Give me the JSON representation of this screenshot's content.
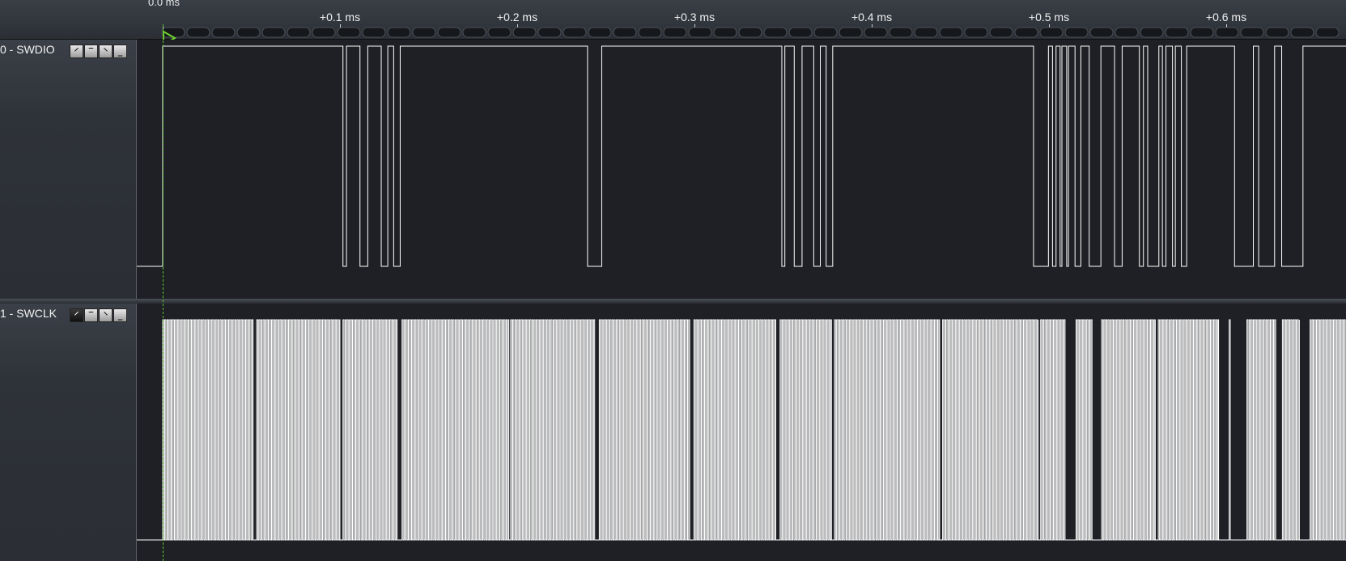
{
  "ruler": {
    "origin_label": "0.0 ms",
    "ticks": [
      "+0.1 ms",
      "+0.2 ms",
      "+0.3 ms",
      "+0.4 ms",
      "+0.5 ms",
      "+0.6 ms"
    ]
  },
  "channels": [
    {
      "name": "0 - SWDIO",
      "trigger_options": [
        "rising-edge-icon",
        "high-level-icon",
        "falling-edge-icon",
        "low-level-icon"
      ],
      "active_trigger": "none"
    },
    {
      "name": "1 - SWCLK",
      "trigger_options": [
        "rising-edge-icon",
        "high-level-icon",
        "falling-edge-icon",
        "low-level-icon"
      ],
      "active_trigger": "rising-edge-icon"
    }
  ],
  "colors": {
    "trace": "#ffffff",
    "trigger_marker": "#6fd22e",
    "background": "#1e2025"
  },
  "signals": {
    "time_unit": "ms",
    "time_start": 0.0,
    "swdio_low_intervals_ms": [
      [
        -0.015,
        0.0
      ],
      [
        0.1017,
        0.1037
      ],
      [
        0.1113,
        0.1157
      ],
      [
        0.1233,
        0.127
      ],
      [
        0.1303,
        0.134
      ],
      [
        0.2397,
        0.2477
      ],
      [
        0.3493,
        0.351
      ],
      [
        0.3563,
        0.3607
      ],
      [
        0.3673,
        0.371
      ],
      [
        0.3743,
        0.378
      ],
      [
        0.4913,
        0.4997
      ],
      [
        0.502,
        0.504
      ],
      [
        0.5063,
        0.5073
      ],
      [
        0.51,
        0.511
      ],
      [
        0.5147,
        0.518
      ],
      [
        0.5227,
        0.5293
      ],
      [
        0.537,
        0.5413
      ],
      [
        0.551,
        0.5533
      ],
      [
        0.5557,
        0.562
      ],
      [
        0.564,
        0.566
      ],
      [
        0.5697,
        0.5713
      ],
      [
        0.5747,
        0.5777
      ],
      [
        0.6047,
        0.6153
      ],
      [
        0.6183,
        0.6273
      ],
      [
        0.6313,
        0.6433
      ]
    ],
    "swclk_burst_intervals_ms": [
      [
        0.0,
        0.0513
      ],
      [
        0.053,
        0.1
      ],
      [
        0.1017,
        0.1323
      ],
      [
        0.135,
        0.1953
      ],
      [
        0.1963,
        0.244
      ],
      [
        0.2463,
        0.2977
      ],
      [
        0.2997,
        0.3463
      ],
      [
        0.3483,
        0.3773
      ],
      [
        0.379,
        0.4383
      ],
      [
        0.44,
        0.494
      ],
      [
        0.4953,
        0.5093
      ],
      [
        0.5153,
        0.5243
      ],
      [
        0.5297,
        0.56
      ],
      [
        0.5617,
        0.5957
      ],
      [
        0.6017,
        0.6027
      ],
      [
        0.6117,
        0.628
      ],
      [
        0.6317,
        0.6413
      ],
      [
        0.6473,
        0.67
      ]
    ],
    "swclk_period_ms": 0.0012
  }
}
